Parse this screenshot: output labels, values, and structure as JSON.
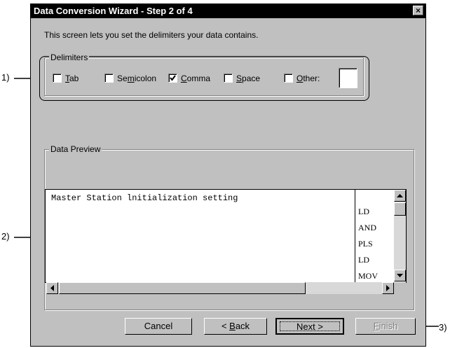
{
  "window": {
    "title": "Data Conversion Wizard - Step 2 of 4",
    "close_glyph": "×"
  },
  "intro_text": "This screen lets you set the delimiters your data contains.",
  "delimiters": {
    "group_label": "Delimiters",
    "options": [
      {
        "pre": "",
        "mnemonic": "T",
        "post": "ab",
        "checked": false
      },
      {
        "pre": "Se",
        "mnemonic": "m",
        "post": "icolon",
        "checked": false
      },
      {
        "pre": "",
        "mnemonic": "C",
        "post": "omma",
        "checked": true
      },
      {
        "pre": "",
        "mnemonic": "S",
        "post": "pace",
        "checked": false
      },
      {
        "pre": "",
        "mnemonic": "O",
        "post": "ther:",
        "checked": false
      }
    ],
    "other_value": ""
  },
  "preview": {
    "group_label": "Data Preview",
    "first_line": "Master Station lnitialization setting",
    "right_column": [
      "LD",
      "AND",
      "PLS",
      "LD",
      "MOV"
    ]
  },
  "buttons": {
    "cancel": "Cancel",
    "back_pre": "< ",
    "back_mnemonic": "B",
    "back_post": "ack",
    "next": "Next >",
    "finish_mnemonic": "F",
    "finish_post": "inish"
  },
  "callouts": {
    "one": "1)",
    "two": "2)",
    "three": "3)"
  },
  "colors": {
    "titlebar": "#000000",
    "window": "#c0c0c0",
    "disabled_text": "#808080"
  }
}
